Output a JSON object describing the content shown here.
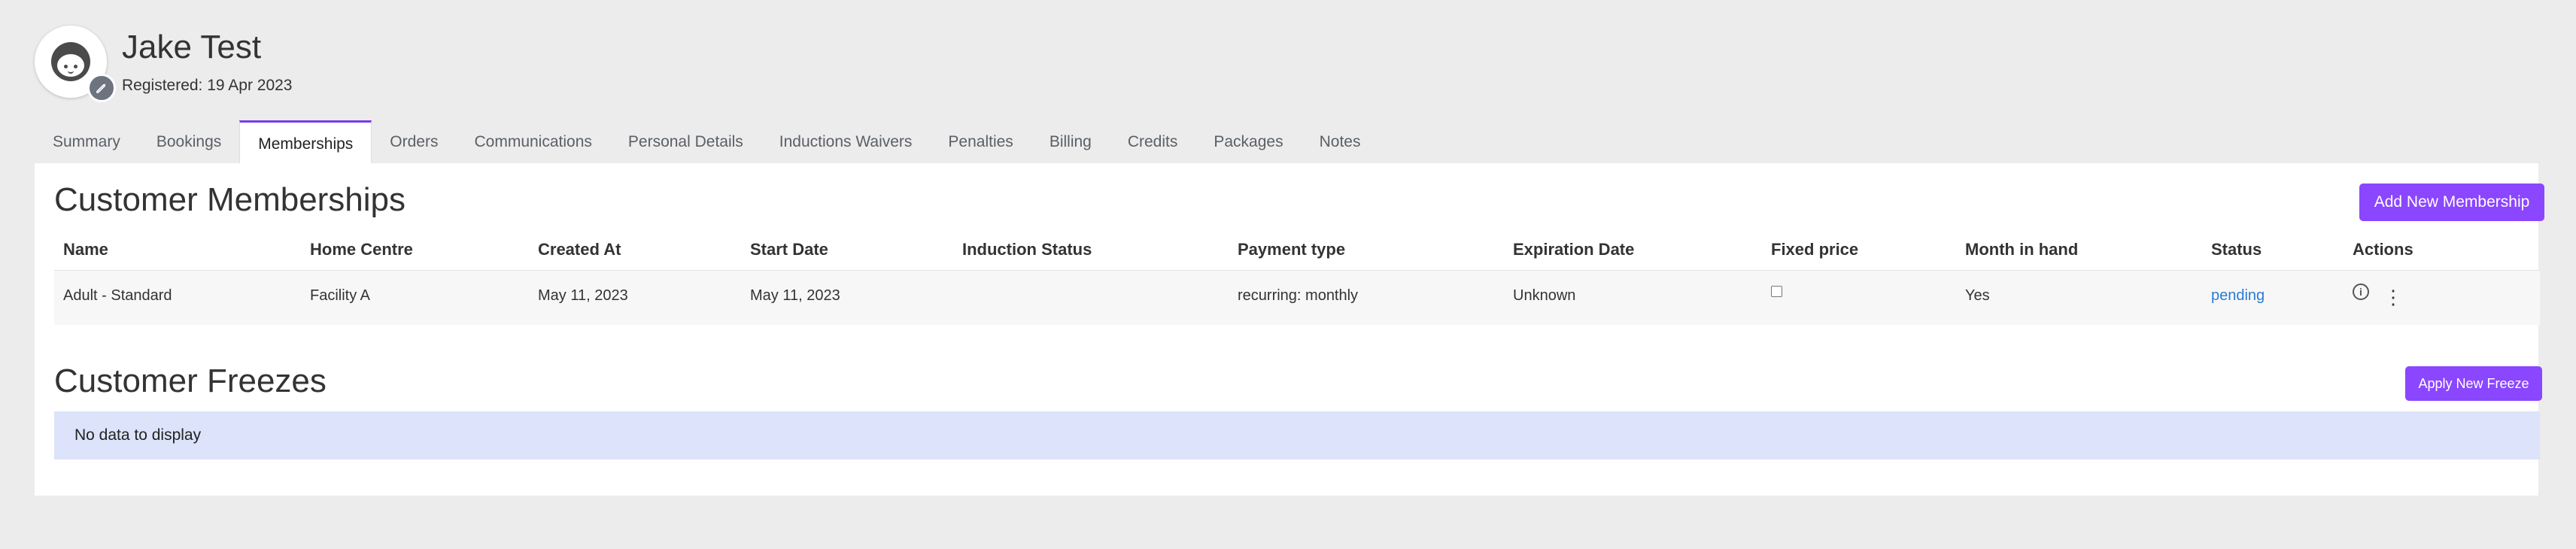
{
  "customer": {
    "name": "Jake Test",
    "registered": "Registered: 19 Apr 2023"
  },
  "tabs": [
    {
      "label": "Summary"
    },
    {
      "label": "Bookings"
    },
    {
      "label": "Memberships",
      "active": true
    },
    {
      "label": "Orders"
    },
    {
      "label": "Communications"
    },
    {
      "label": "Personal Details"
    },
    {
      "label": "Inductions Waivers"
    },
    {
      "label": "Penalties"
    },
    {
      "label": "Billing"
    },
    {
      "label": "Credits"
    },
    {
      "label": "Packages"
    },
    {
      "label": "Notes"
    }
  ],
  "memberships": {
    "title": "Customer Memberships",
    "add_button": "Add New Membership",
    "columns": [
      "Name",
      "Home Centre",
      "Created At",
      "Start Date",
      "Induction Status",
      "Payment type",
      "Expiration Date",
      "Fixed price",
      "Month in hand",
      "Status",
      "Actions"
    ],
    "rows": [
      {
        "name": "Adult - Standard",
        "home_centre": "Facility A",
        "created_at": "May 11, 2023",
        "start_date": "May 11, 2023",
        "induction_status": "",
        "payment_type": "recurring: monthly",
        "expiration_date": "Unknown",
        "fixed_price": false,
        "month_in_hand": "Yes",
        "status": "pending",
        "actions": [
          "info-icon",
          "more-vertical-icon"
        ]
      }
    ]
  },
  "freezes": {
    "title": "Customer Freezes",
    "apply_button": "Apply New Freeze",
    "empty_text": "No data to display"
  },
  "colors": {
    "accent": "#8b46ff",
    "active_tab_border": "#7c3aed",
    "status_link": "#2a7bd3",
    "empty_banner": "#dce3fa",
    "page_bg": "#ececec"
  }
}
